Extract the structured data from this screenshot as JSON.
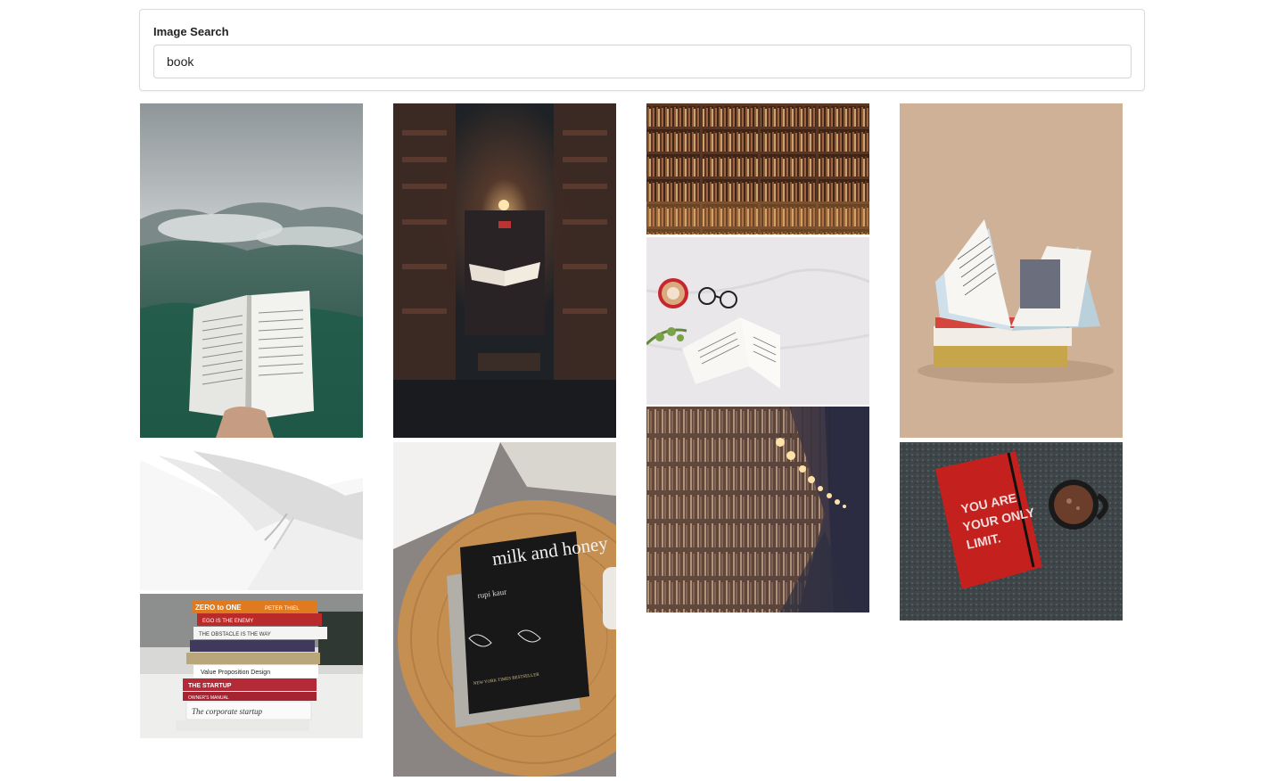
{
  "search": {
    "label": "Image Search",
    "value": "book"
  },
  "results": [
    {
      "subject": "open book held up against misty forested mountains"
    },
    {
      "subject": "close-up of white book pages with ribbon bookmark"
    },
    {
      "subject": "stack of business books on a table"
    },
    {
      "subject": "open book floating in dark bookstore tunnel"
    },
    {
      "subject": "black book on round wooden side table"
    },
    {
      "subject": "wall of wooden library bookshelves"
    },
    {
      "subject": "open book with coffee cup and glasses on white sheet"
    },
    {
      "subject": "library aisle with hanging light bulbs"
    },
    {
      "subject": "open magazine on stack of books, beige background"
    },
    {
      "subject": "red notebook next to mug of hot chocolate on grey rug"
    }
  ],
  "book_text": {
    "milk_title": "milk and honey",
    "milk_author": "rupi kaur",
    "milk_footer": "NEW YORK TIMES BESTSELLER",
    "notebook": [
      "YOU ARE",
      "YOUR ONLY",
      "LIMIT."
    ],
    "spines": [
      "ZERO to ONE",
      "PETER THIEL",
      "EGO IS THE ENEMY",
      "THE OBSTACLE IS THE WAY",
      "Value Proposition Design",
      "THE STARTUP",
      "OWNER'S MANUAL",
      "The corporate startup"
    ]
  }
}
